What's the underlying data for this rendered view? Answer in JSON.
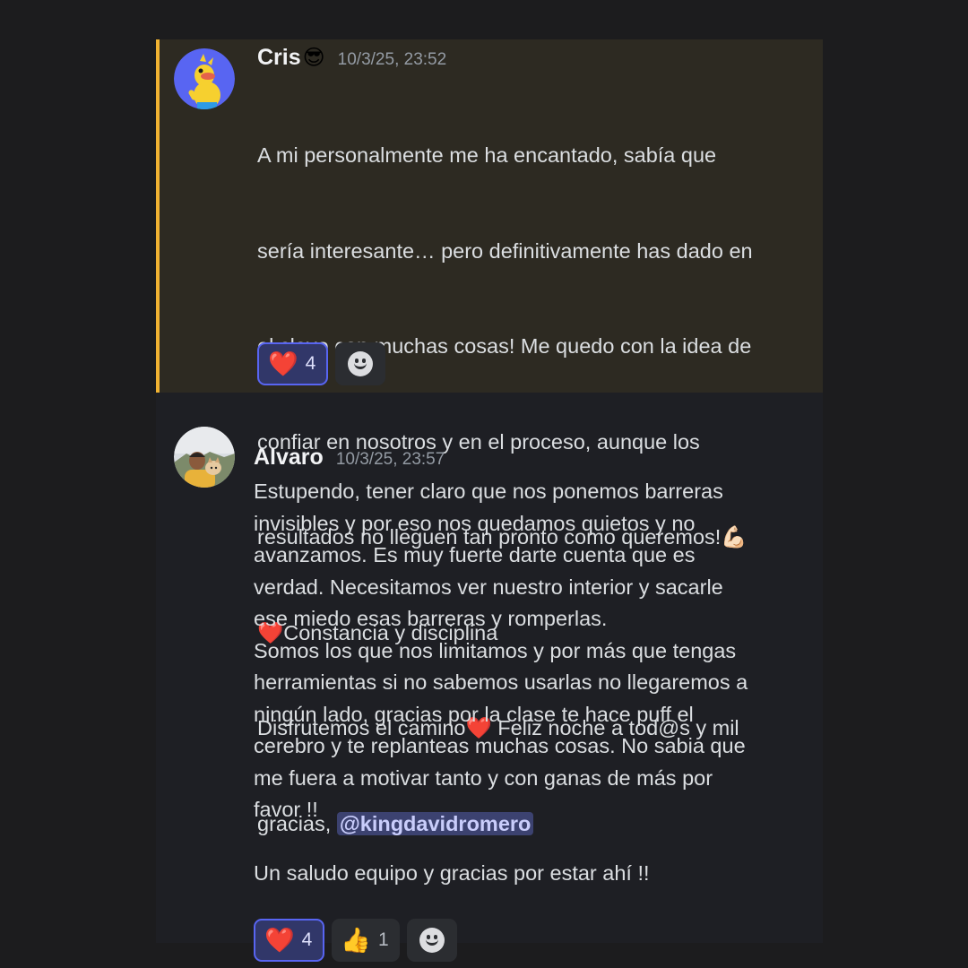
{
  "messages": [
    {
      "username": "Cris",
      "username_emoji": "😎",
      "timestamp": "10/3/25, 23:52",
      "lines": [
        "A mi personalmente me ha encantado, sabía que",
        "sería interesante… pero definitivamente has dado en",
        "el clavo con muchas cosas! Me quedo con la idea de",
        "confiar en nosotros y en el proceso, aunque los",
        "resultados no lleguen tan pronto como queremos!💪🏻",
        "❤️Constancia y disciplina",
        "Disfrutemos el camino❤️ Feliz noche a tod@s y mil"
      ],
      "last_line_prefix": "gracias, ",
      "mention": "@kingdavidromero",
      "highlighted": true,
      "accent_color": "#f0b232",
      "reactions": [
        {
          "emoji": "❤️",
          "count": "4",
          "me": true
        }
      ],
      "add_reaction_icon": "smile-icon"
    },
    {
      "username": "Alvaro",
      "timestamp": "10/3/25, 23:57",
      "text": "Estupendo, tener claro que nos ponemos barreras\ninvisibles y por eso nos quedamos quietos y no\navanzamos. Es muy fuerte darte cuenta que es\nverdad. Necesitamos ver nuestro interior y sacarle\nese miedo esas barreras y romperlas.\nSomos los que nos limitamos y por más que tengas\nherramientas si no sabemos usarlas no llegaremos a\nningún lado, gracias por la clase te hace puff el\ncerebro y te replanteas muchas cosas. No sabia que\nme fuera a motivar tanto y con ganas de más por\nfavor !!\n\nUn saludo equipo y gracias por estar ahí !!",
      "reactions": [
        {
          "emoji": "❤️",
          "count": "4",
          "me": true
        },
        {
          "emoji": "👍",
          "count": "1",
          "me": false
        }
      ],
      "add_reaction_icon": "smile-icon"
    }
  ]
}
